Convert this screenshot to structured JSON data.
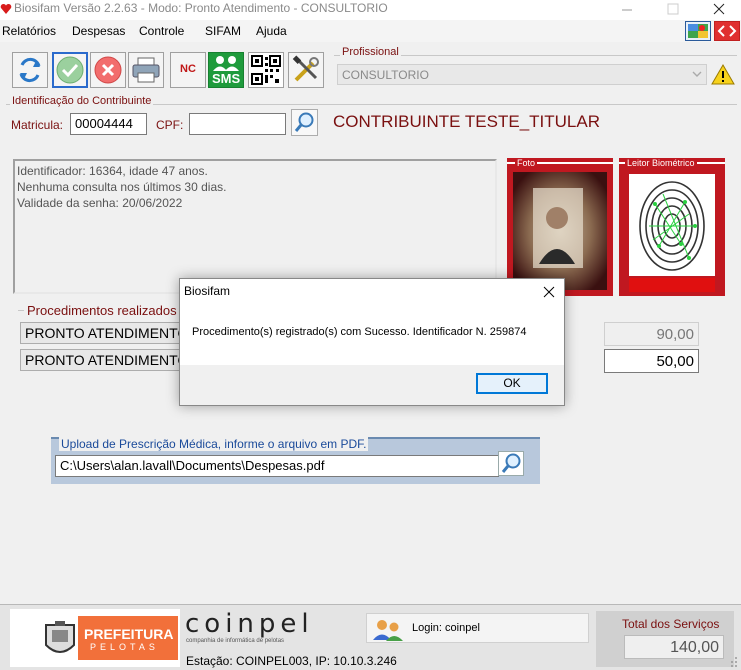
{
  "window": {
    "title": "Biosifam Versão 2.2.63 - Modo: Pronto Atendimento - CONSULTORIO"
  },
  "menu": [
    "Relatórios",
    "Despesas",
    "Controle",
    "SIFAM",
    "Ajuda"
  ],
  "toolbar": {
    "nc_label": "NC",
    "sms_label": "SMS"
  },
  "profissional": {
    "label": "Profissional",
    "value": "CONSULTORIO"
  },
  "contribuinte": {
    "label": "Identificação do Contribuinte",
    "matricula_label": "Matricula:",
    "matricula_value": "00004444",
    "cpf_label": "CPF:",
    "cpf_value": "",
    "name": "CONTRIBUINTE TESTE_TITULAR"
  },
  "info_lines": [
    "Identificador: 16364, idade 47 anos.",
    "Nenhuma consulta nos últimos 30 dias.",
    "Validade da senha: 20/06/2022"
  ],
  "foto": {
    "label": "Foto"
  },
  "leitor": {
    "label": "Leitor Biométrico"
  },
  "procedimentos": {
    "label": "Procedimentos realizados :",
    "items": [
      {
        "name": "PRONTO ATENDIMENTO",
        "value": "90,00"
      },
      {
        "name": "PRONTO ATENDIMENTO",
        "value": "50,00"
      }
    ]
  },
  "upload": {
    "label": "Upload de Prescrição Médica, informe o arquivo em PDF.",
    "path": "C:\\Users\\alan.lavall\\Documents\\Despesas.pdf"
  },
  "dialog": {
    "title": "Biosifam",
    "message": "Procedimento(s) registrado(s) com Sucesso. Identificador N. 259874",
    "ok_label": "OK"
  },
  "footer": {
    "prefeitura_line1": "PREFEITURA",
    "prefeitura_line2": "PELOTAS",
    "coinpel_logo": "coinpel",
    "coinpel_tagline": "companhia de informática de pelotas",
    "login": "Login: coinpel",
    "estacao": "Estação: COINPEL003, IP: 10.10.3.246",
    "total_label": "Total dos Serviços",
    "total_value": "140,00"
  },
  "colors": {
    "accent_red": "#7a1010",
    "upload_blue": "#b8c8dc",
    "foto_red": "#b0151c"
  }
}
